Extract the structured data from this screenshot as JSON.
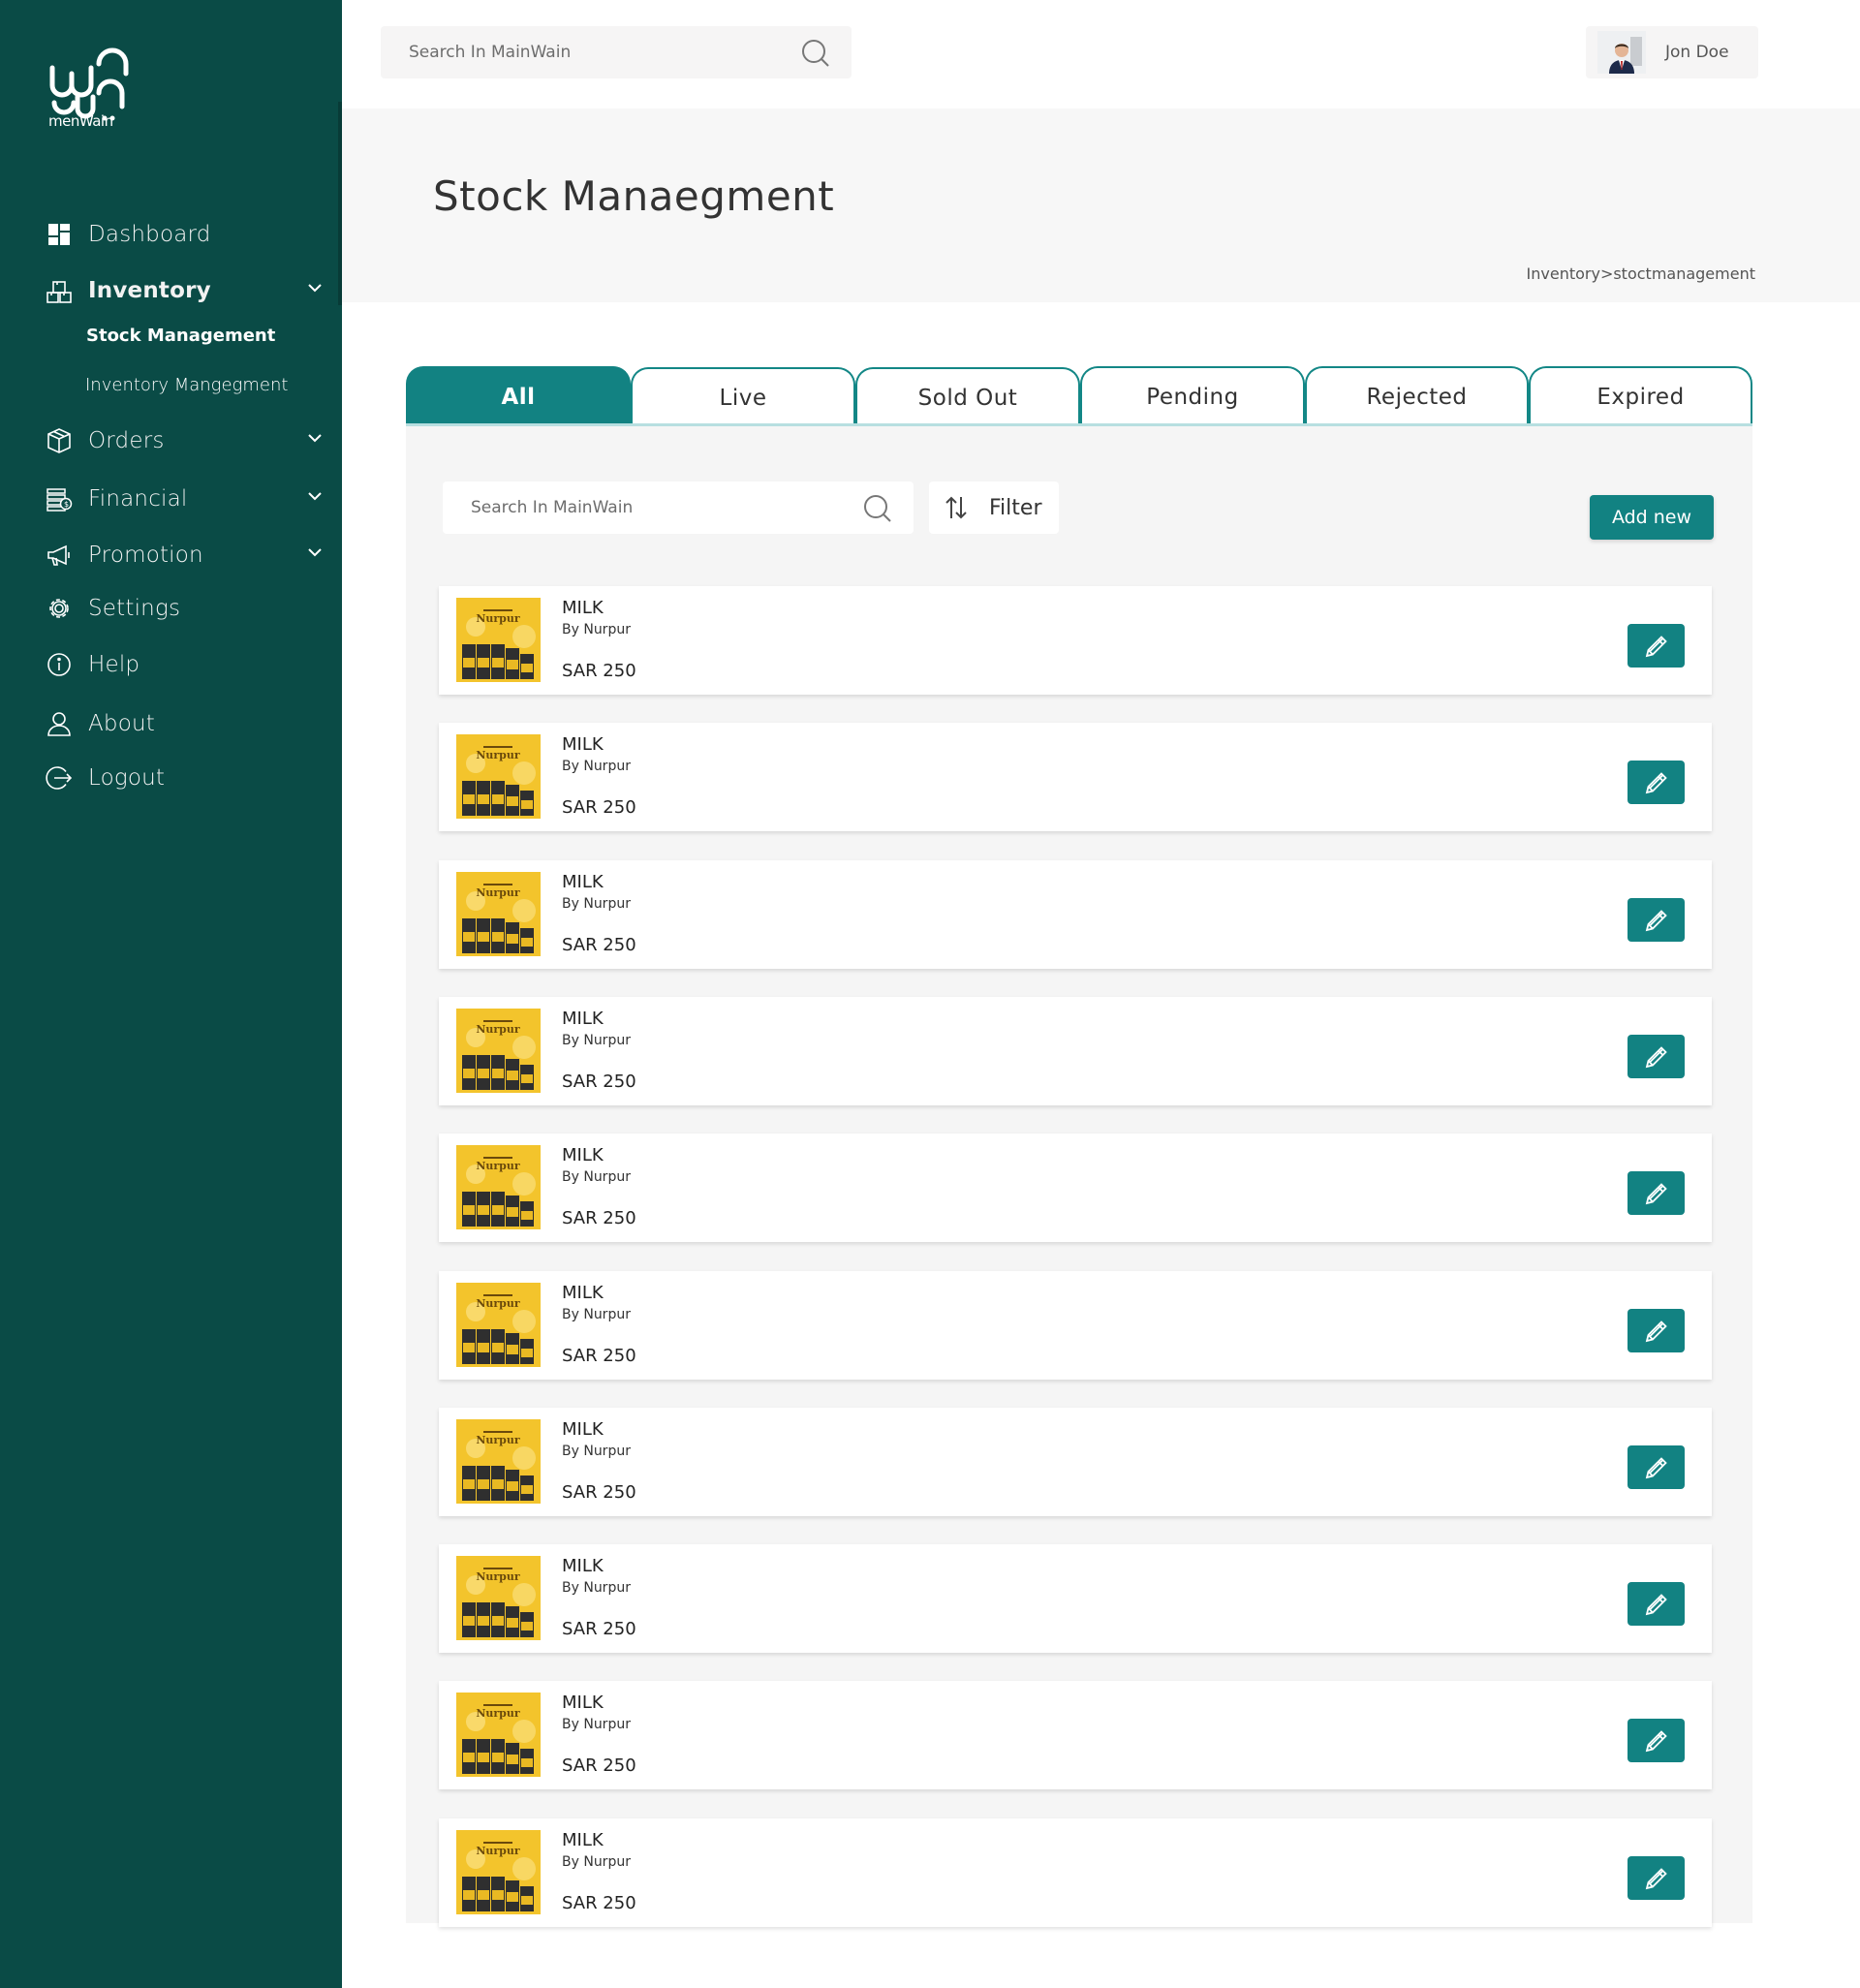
{
  "brand": {
    "logo_text": "menWain"
  },
  "topbar": {
    "search_placeholder": "Search In MainWain",
    "user_name": "Jon Doe"
  },
  "sidebar": {
    "items": [
      {
        "label": "Dashboard",
        "icon": "dashboard-icon"
      },
      {
        "label": "Inventory",
        "icon": "inventory-icon",
        "expanded": true
      },
      {
        "label": "Orders",
        "icon": "box-icon"
      },
      {
        "label": "Financial",
        "icon": "money-icon"
      },
      {
        "label": "Promotion",
        "icon": "megaphone-icon"
      },
      {
        "label": "Settings",
        "icon": "gear-icon"
      },
      {
        "label": "Help",
        "icon": "info-icon"
      },
      {
        "label": "About",
        "icon": "user-icon"
      },
      {
        "label": "Logout",
        "icon": "logout-icon"
      }
    ],
    "inventory_sub": [
      {
        "label": "Stock Management",
        "active": true
      },
      {
        "label": "Inventory Mangegment"
      }
    ]
  },
  "page": {
    "title": "Stock Manaegment",
    "breadcrumb": "Inventory>stoctmanagement"
  },
  "tabs": [
    {
      "label": "All",
      "active": true
    },
    {
      "label": "Live"
    },
    {
      "label": "Sold Out"
    },
    {
      "label": "Pending"
    },
    {
      "label": "Rejected"
    },
    {
      "label": "Expired"
    }
  ],
  "toolbar": {
    "search_placeholder": "Search In MainWain",
    "filter_label": "Filter",
    "add_label": "Add new"
  },
  "products": [
    {
      "name": "MILK",
      "brand": "By Nurpur",
      "price": "SAR 250"
    },
    {
      "name": "MILK",
      "brand": "By Nurpur",
      "price": "SAR 250"
    },
    {
      "name": "MILK",
      "brand": "By Nurpur",
      "price": "SAR 250"
    },
    {
      "name": "MILK",
      "brand": "By Nurpur",
      "price": "SAR 250"
    },
    {
      "name": "MILK",
      "brand": "By Nurpur",
      "price": "SAR 250"
    },
    {
      "name": "MILK",
      "brand": "By Nurpur",
      "price": "SAR 250"
    },
    {
      "name": "MILK",
      "brand": "By Nurpur",
      "price": "SAR 250"
    },
    {
      "name": "MILK",
      "brand": "By Nurpur",
      "price": "SAR 250"
    },
    {
      "name": "MILK",
      "brand": "By Nurpur",
      "price": "SAR 250"
    },
    {
      "name": "MILK",
      "brand": "By Nurpur",
      "price": "SAR 250"
    }
  ],
  "colors": {
    "sidebar": "#0a4b46",
    "accent": "#128282",
    "thumb": "#f3c42c"
  }
}
